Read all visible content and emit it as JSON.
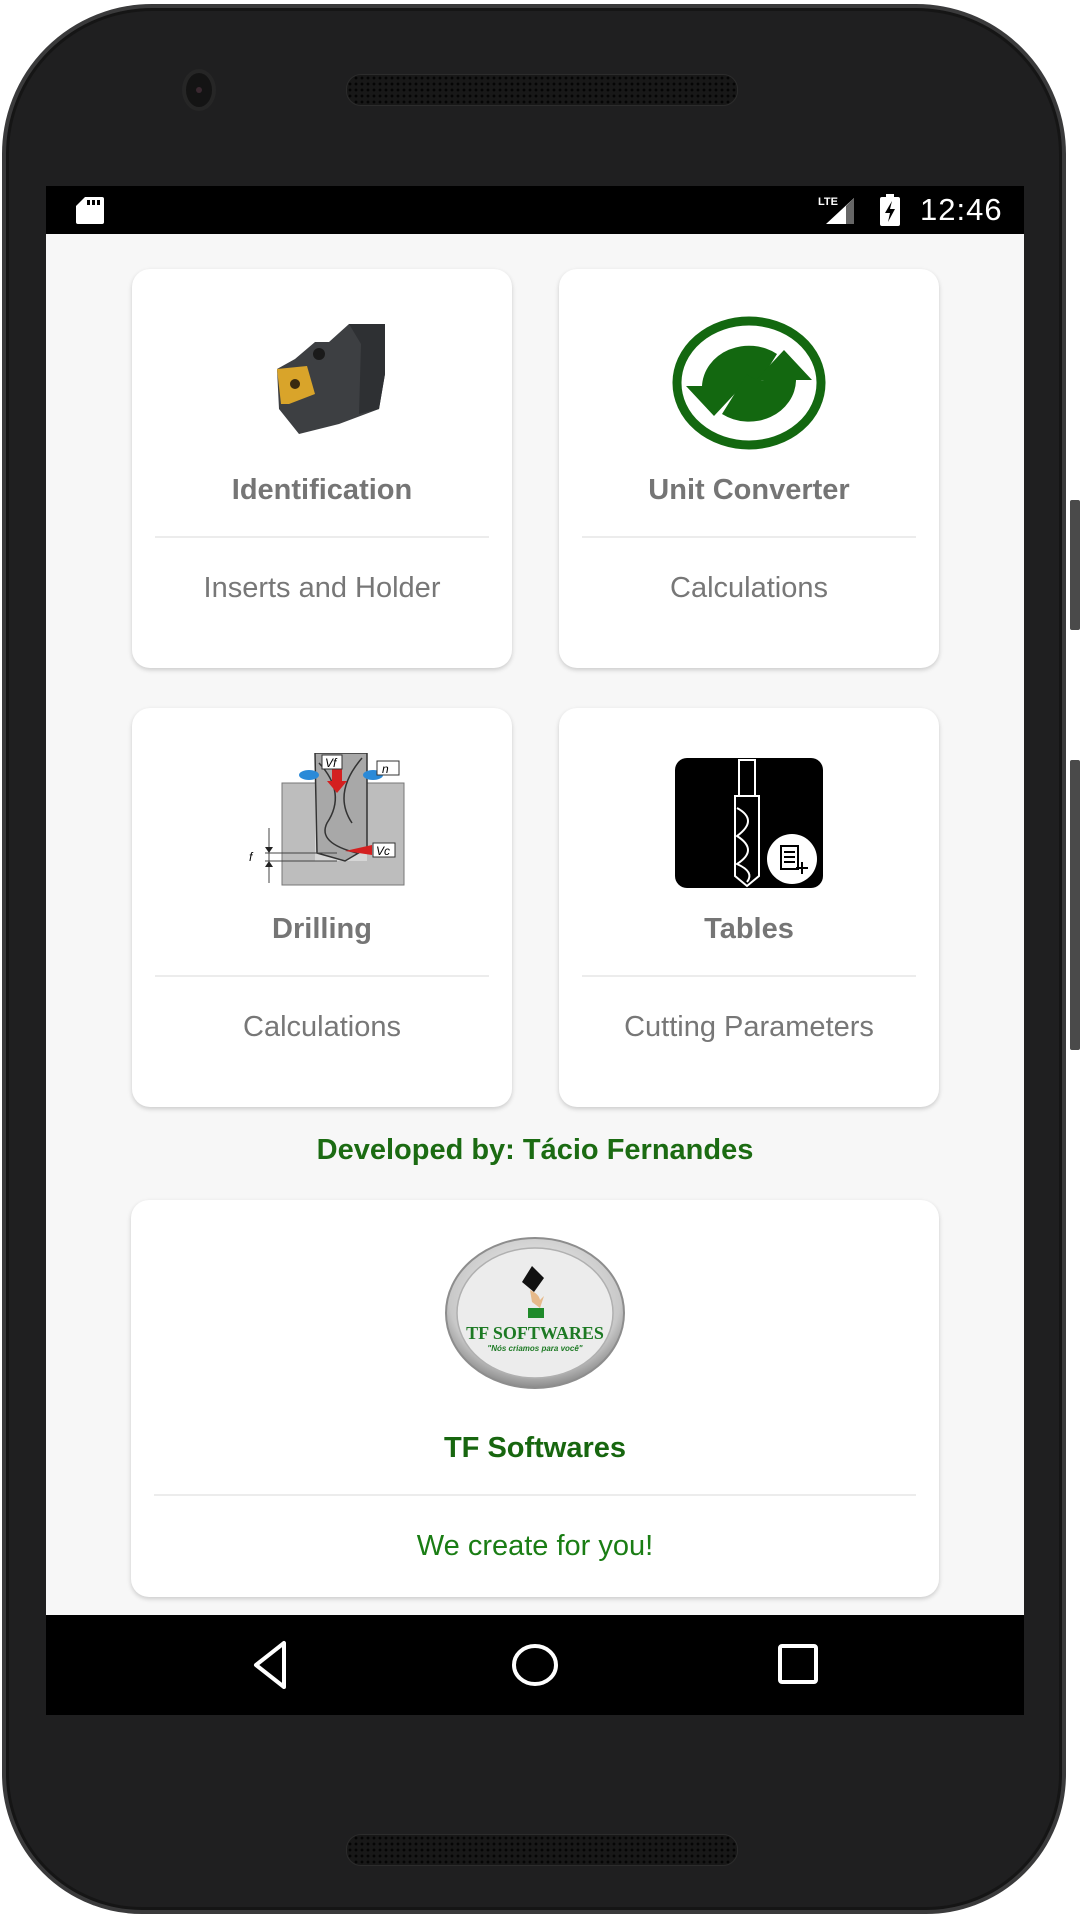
{
  "status_bar": {
    "time": "12:46",
    "left_icons": [
      "sd-card-icon"
    ],
    "right_icons": [
      "lte-signal-icon",
      "battery-charging-icon"
    ],
    "network_label": "LTE"
  },
  "menu_cards": [
    {
      "title": "Identification",
      "subtitle": "Inserts and Holder",
      "icon": "tool-holder-insert-icon"
    },
    {
      "title": "Unit Converter",
      "subtitle": "Calculations",
      "icon": "convert-arrows-icon"
    },
    {
      "title": "Drilling",
      "subtitle": "Calculations",
      "icon": "drilling-diagram-icon"
    },
    {
      "title": "Tables",
      "subtitle": "Cutting Parameters",
      "icon": "drill-table-icon"
    }
  ],
  "drilling_diagram_labels": {
    "feed_speed": "Vf",
    "rotation": "n",
    "cutting_speed": "Vc",
    "feed": "f"
  },
  "developer": {
    "label": "Developed by: Tácio Fernandes"
  },
  "company_card": {
    "logo_text": "TF SOFTWARES",
    "logo_slogan": "\"Nós criamos para você\"",
    "title": "TF Softwares",
    "subtitle": "We create for you!"
  },
  "nav_bar": {
    "buttons": [
      "back-icon",
      "home-icon",
      "recents-icon"
    ]
  },
  "colors": {
    "accent_green": "#1b6b12",
    "card_text_gray": "#757575",
    "background": "#f7f7f7"
  }
}
